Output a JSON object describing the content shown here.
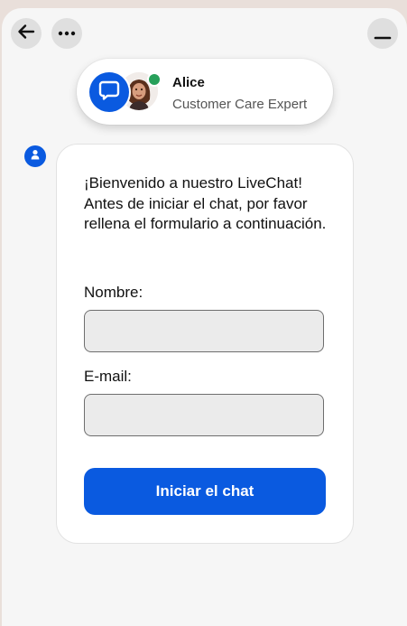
{
  "header": {
    "back_icon": "arrow-left-icon",
    "more_icon": "ellipsis-icon",
    "minimize_icon": "minimize-icon"
  },
  "agent": {
    "name": "Alice",
    "role": "Customer Care Expert",
    "status": "online",
    "status_color": "#27a05a",
    "logo_icon": "chat-bubble-icon"
  },
  "form": {
    "welcome": "¡Bienvenido a nuestro LiveChat! Antes de iniciar el chat, por favor rellena el formulario a continuación.",
    "name_label": "Nombre:",
    "name_value": "",
    "email_label": "E-mail:",
    "email_value": "",
    "submit_label": "Iniciar el chat"
  },
  "colors": {
    "accent": "#0a5ae0",
    "background": "#f6f6f6",
    "input_background": "#ebebeb"
  }
}
